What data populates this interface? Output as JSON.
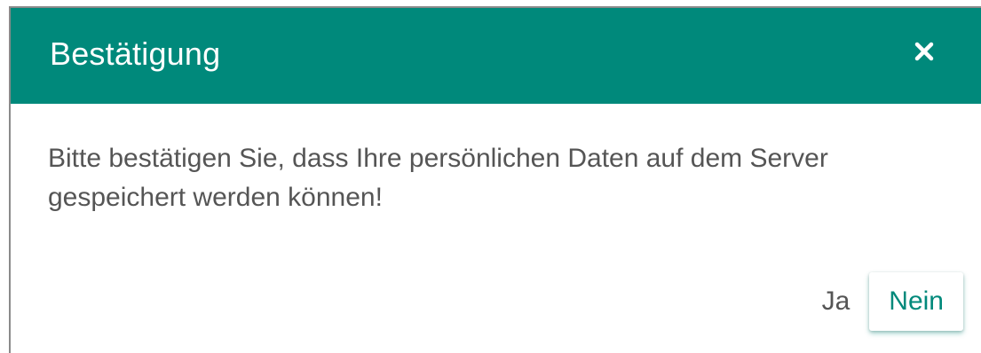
{
  "dialog": {
    "title": "Bestätigung",
    "close_icon": "close-icon",
    "message": "Bitte bestätigen Sie, dass Ihre persönlichen Daten auf dem Server gespeichert werden können!",
    "buttons": {
      "yes_label": "Ja",
      "no_label": "Nein"
    }
  },
  "colors": {
    "header_background": "#00897b",
    "header_text": "#ffffff",
    "body_text": "#555555",
    "primary_button_text": "#00897b"
  }
}
